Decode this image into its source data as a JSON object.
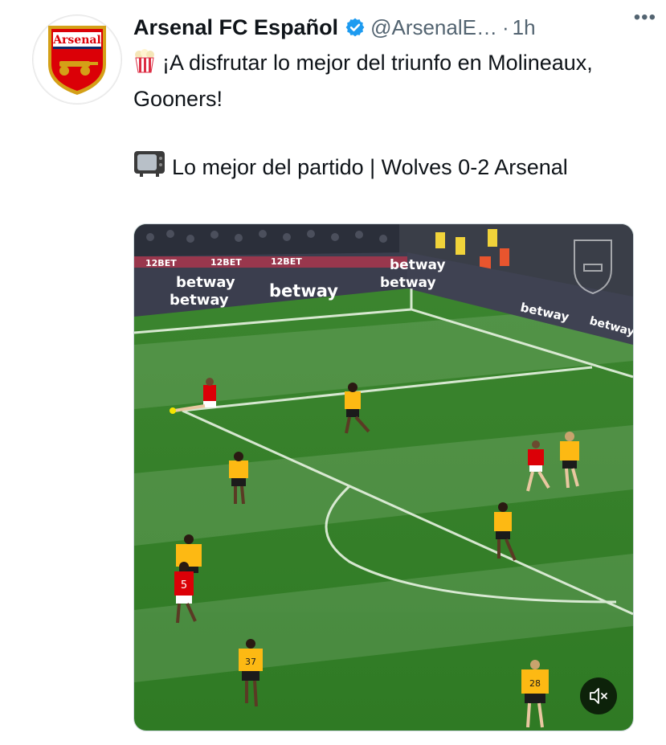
{
  "account": {
    "name": "Arsenal FC Español",
    "handle": "@ArsenalE…",
    "separator": "·",
    "time": "1h",
    "avatar_text": "Arsenal"
  },
  "post": {
    "line1_icon": "popcorn-emoji",
    "line1": "¡A disfrutar lo mejor del triunfo en Molineaux, Gooners!",
    "line2_icon": "television-emoji",
    "line2": "Lo mejor del partido | Wolves 0-2 Arsenal"
  },
  "media": {
    "ad_boards": [
      "betway",
      "betway",
      "betway",
      "betway",
      "betway",
      "betway",
      "betway"
    ],
    "ad_top": [
      "12BET",
      "12BET",
      "12BET"
    ],
    "mute_icon": "muted-speaker-icon"
  },
  "colors": {
    "accent_blue": "#1d9bf0",
    "arsenal_red": "#db0007",
    "pitch_green": "#3f8a2e",
    "wolves_gold": "#fdb913"
  }
}
